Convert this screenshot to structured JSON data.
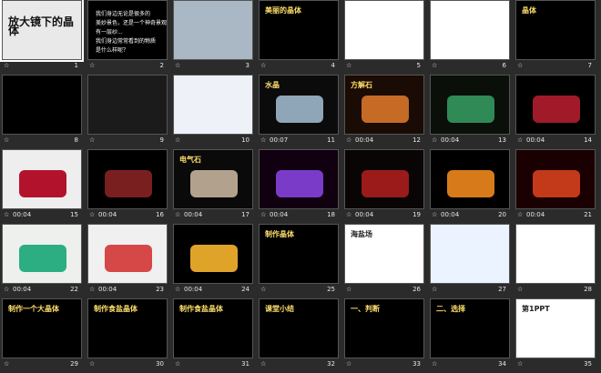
{
  "slides": [
    {
      "n": "1",
      "time": "",
      "title": "放大镜下的晶体",
      "subtitle": "",
      "bg": "#e9e9e9"
    },
    {
      "n": "2",
      "time": "",
      "title": "",
      "bg": "#000000",
      "lines": [
        "我们身边无论是很多的",
        "美妙景色，还是一个神奇景观",
        "有一层纱...",
        "我们身边常常看到的物质",
        "是什么样呢？"
      ]
    },
    {
      "n": "3",
      "time": "",
      "title": "",
      "bg": "#aab7c4"
    },
    {
      "n": "4",
      "time": "",
      "title": "美丽的晶体",
      "bg": "#000000"
    },
    {
      "n": "5",
      "time": "",
      "title": "",
      "bg": "#ffffff"
    },
    {
      "n": "6",
      "time": "",
      "title": "",
      "bg": "#ffffff"
    },
    {
      "n": "7",
      "time": "",
      "title": "晶体",
      "bg": "#000000"
    },
    {
      "n": "8",
      "time": "",
      "title": "",
      "bg": "#000000"
    },
    {
      "n": "9",
      "time": "",
      "title": "",
      "bg": "#1b1b1b"
    },
    {
      "n": "10",
      "time": "",
      "title": "",
      "bg": "#eef2f8"
    },
    {
      "n": "11",
      "time": "00:07",
      "title": "水晶",
      "bg": "#0b0b0b"
    },
    {
      "n": "12",
      "time": "00:04",
      "title": "方解石",
      "bg": "#1a0b05"
    },
    {
      "n": "13",
      "time": "00:04",
      "title": "",
      "bg": "#0a0f0a"
    },
    {
      "n": "14",
      "time": "00:04",
      "title": "",
      "bg": "#000000"
    },
    {
      "n": "15",
      "time": "00:04",
      "title": "",
      "bg": "#eeeeee"
    },
    {
      "n": "16",
      "time": "00:04",
      "title": "",
      "bg": "#000000"
    },
    {
      "n": "17",
      "time": "00:04",
      "title": "电气石",
      "bg": "#0a0a0a"
    },
    {
      "n": "18",
      "time": "00:04",
      "title": "",
      "bg": "#100010"
    },
    {
      "n": "19",
      "time": "00:04",
      "title": "",
      "bg": "#0a0505"
    },
    {
      "n": "20",
      "time": "00:04",
      "title": "",
      "bg": "#000000"
    },
    {
      "n": "21",
      "time": "00:04",
      "title": "",
      "bg": "#1a0000"
    },
    {
      "n": "22",
      "time": "00:04",
      "title": "",
      "bg": "#eef0ee"
    },
    {
      "n": "23",
      "time": "00:04",
      "title": "",
      "bg": "#f0f0f0"
    },
    {
      "n": "24",
      "time": "00:04",
      "title": "",
      "bg": "#000000"
    },
    {
      "n": "25",
      "time": "",
      "title": "制作晶体",
      "bg": "#000000"
    },
    {
      "n": "26",
      "time": "",
      "title": "海盐场",
      "bg": "#ffffff"
    },
    {
      "n": "27",
      "time": "",
      "title": "",
      "bg": "#eaf3ff"
    },
    {
      "n": "28",
      "time": "",
      "title": "",
      "bg": "#ffffff"
    },
    {
      "n": "29",
      "time": "",
      "title": "制作一个大晶体",
      "bg": "#000000"
    },
    {
      "n": "30",
      "time": "",
      "title": "制作食盐晶体",
      "bg": "#000000"
    },
    {
      "n": "31",
      "time": "",
      "title": "制作食盐晶体",
      "bg": "#000000"
    },
    {
      "n": "32",
      "time": "",
      "title": "课堂小结",
      "bg": "#000000"
    },
    {
      "n": "33",
      "time": "",
      "title": "一、判断",
      "bg": "#000000"
    },
    {
      "n": "34",
      "time": "",
      "title": "二、选择",
      "bg": "#000000"
    },
    {
      "n": "35",
      "time": "",
      "title": "第1PPT",
      "bg": "#ffffff"
    }
  ],
  "icons": {
    "star": "star-icon"
  }
}
